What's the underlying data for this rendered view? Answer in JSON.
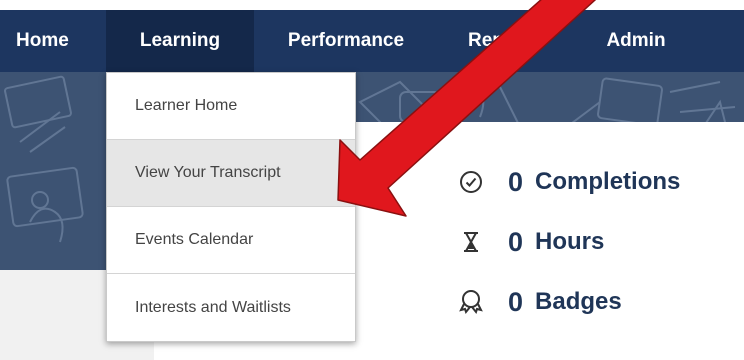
{
  "nav": {
    "home": "Home",
    "learning": "Learning",
    "performance": "Performance",
    "reports": "Rep",
    "admin": "Admin"
  },
  "dropdown": {
    "items": [
      {
        "label": "Learner Home"
      },
      {
        "label": "View Your Transcript"
      },
      {
        "label": "Events Calendar"
      },
      {
        "label": "Interests and Waitlists"
      }
    ]
  },
  "stats": {
    "completions": {
      "value": "0",
      "label": "Completions",
      "icon": "checkmark-circle-icon"
    },
    "hours": {
      "value": "0",
      "label": "Hours",
      "icon": "hourglass-icon"
    },
    "badges": {
      "value": "0",
      "label": "Badges",
      "icon": "badge-ribbon-icon"
    }
  },
  "colors": {
    "nav_bg": "#1d3660",
    "nav_active": "#14284a",
    "banner_bg": "#3d5373",
    "stat_text": "#1f3557",
    "arrow": "#e0171d"
  }
}
